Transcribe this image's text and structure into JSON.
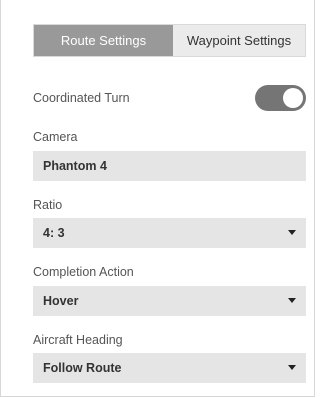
{
  "tabs": {
    "route_settings": "Route Settings",
    "waypoint_settings": "Waypoint Settings",
    "active": "route_settings"
  },
  "coordinated_turn": {
    "label": "Coordinated Turn",
    "enabled": true
  },
  "camera": {
    "label": "Camera",
    "value": "Phantom 4"
  },
  "ratio": {
    "label": "Ratio",
    "value": "4: 3"
  },
  "completion_action": {
    "label": "Completion Action",
    "value": "Hover"
  },
  "aircraft_heading": {
    "label": "Aircraft Heading",
    "value": "Follow Route"
  },
  "colors": {
    "active_tab": "#999999",
    "inactive_tab": "#ebebeb",
    "field_bg": "#e5e5e5",
    "toggle_on": "#757575"
  },
  "icons": {
    "dropdown": "caret-down-icon"
  }
}
